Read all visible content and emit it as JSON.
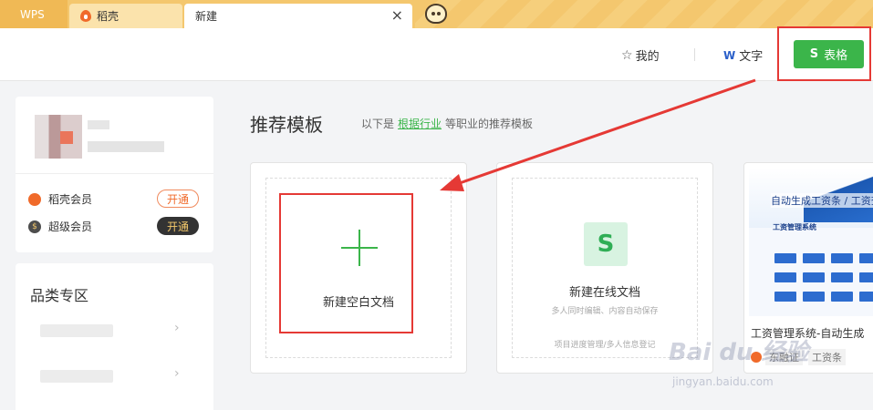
{
  "tabs": [
    {
      "label": "WPS"
    },
    {
      "label": "稻壳"
    },
    {
      "label": "新建"
    }
  ],
  "tab_close": "×",
  "header": {
    "mine_label": "我的",
    "word_label": "文字",
    "sheet_label": "表格",
    "star_glyph": "☆",
    "w_glyph": "W",
    "s_glyph": "S"
  },
  "user": {
    "members": [
      {
        "name": "稻壳会员",
        "action": "开通"
      },
      {
        "name": "超级会员",
        "action": "开通"
      }
    ]
  },
  "category": {
    "title": "品类专区",
    "chevron": "›"
  },
  "main": {
    "title": "推荐模板",
    "subtitle_prefix": "以下是",
    "subtitle_link": "根据行业",
    "subtitle_suffix": "等职业的推荐模板"
  },
  "templates": [
    {
      "label": "新建空白文档"
    },
    {
      "label": "新建在线文档",
      "desc": "多人同时编辑、内容自动保存",
      "desc2": "项目进度管理/多人信息登记",
      "logo": "S"
    },
    {
      "name": "工资管理系统-自动生成",
      "thumb_title": "自动生成工资条 / 工资查",
      "thumb_head": "工资管理系统",
      "tags": [
        "东融证",
        "工资条"
      ]
    }
  ],
  "watermark": {
    "main": "Bai du 经验",
    "sub": "jingyan.baidu.com"
  },
  "colors": {
    "accent_green": "#3bb54a",
    "highlight_red": "#e53935",
    "tab_yellow": "#f4c76e"
  }
}
